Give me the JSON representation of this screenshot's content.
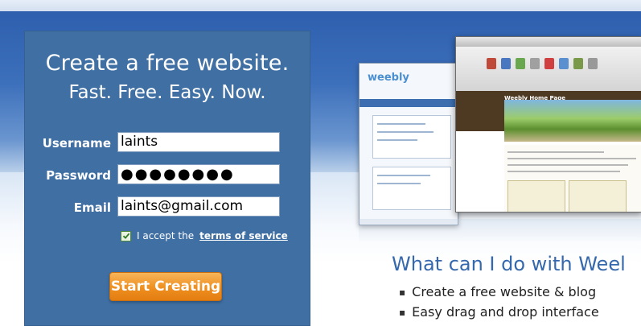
{
  "signup": {
    "headline": "Create a free website.",
    "tagline": "Fast. Free. Easy. Now.",
    "username_label": "Username",
    "username_value": "laints",
    "password_label": "Password",
    "password_value": "●●●●●●●●",
    "email_label": "Email",
    "email_value": "laints@gmail.com",
    "terms_prefix": "I accept the",
    "terms_link": "terms of service",
    "terms_checked": true,
    "submit_label": "Start Creating"
  },
  "preview": {
    "logo": "weebly",
    "site_title": "Weebly Home Page"
  },
  "features": {
    "heading": "What can I do with Weel",
    "items": [
      "Create a free website & blog",
      "Easy drag and drop interface"
    ]
  },
  "colors": {
    "panel": "#3f6fa3",
    "button": "#ef8f1f",
    "heading_blue": "#3568ad"
  }
}
